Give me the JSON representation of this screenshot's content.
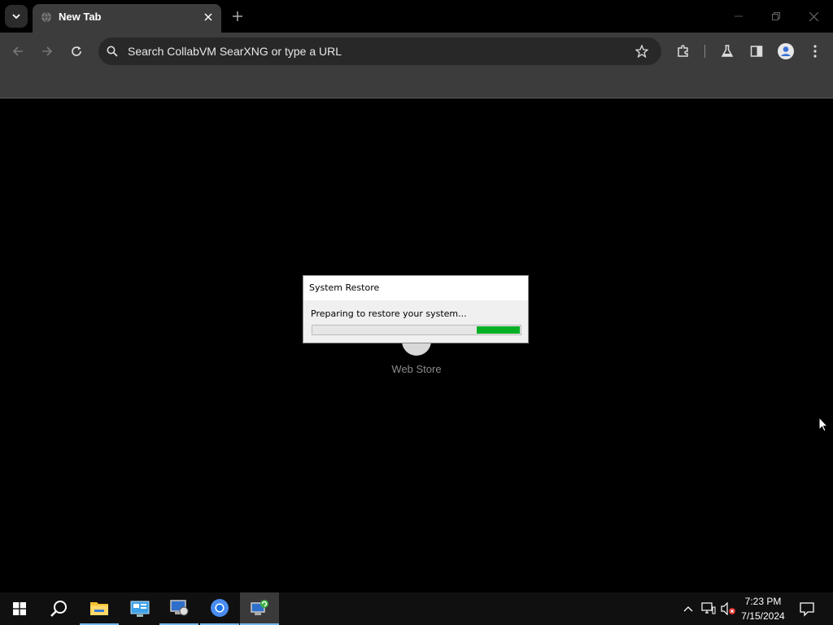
{
  "browser": {
    "tab_title": "New Tab",
    "omnibox_placeholder": "Search CollabVM SearXNG or type a URL"
  },
  "content": {
    "shortcut_label": "Web Store"
  },
  "dialog": {
    "title": "System Restore",
    "message": "Preparing to restore your system...",
    "progress_segment_start": 0.79,
    "progress_segment_end": 1.0,
    "progress_color": "#06b025"
  },
  "taskbar": {
    "apps": [
      "start-icon",
      "search-icon",
      "file-explorer-icon",
      "control-panel-icon",
      "system-properties-icon",
      "chrome-icon",
      "system-restore-icon"
    ],
    "clock_time": "7:23 PM",
    "clock_date": "7/15/2024"
  }
}
